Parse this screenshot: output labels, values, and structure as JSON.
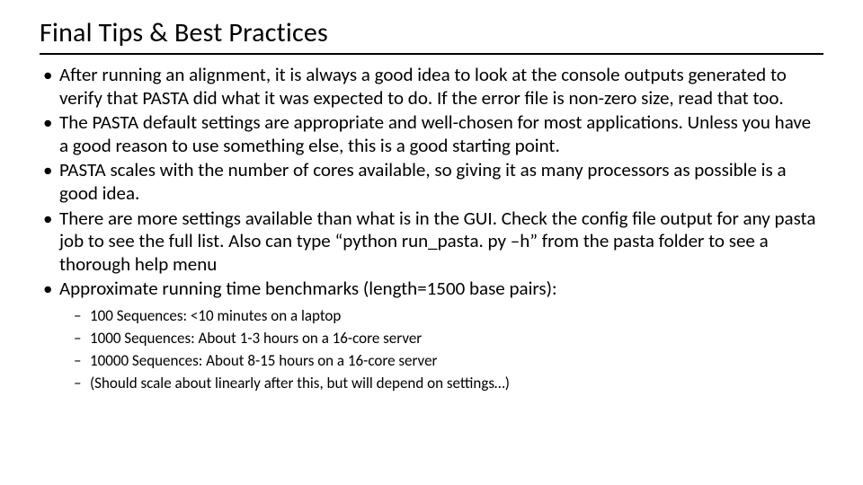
{
  "title": "Final Tips & Best Practices",
  "bullets": [
    "After running an alignment, it is always a good idea to look at the console outputs generated to verify that PASTA did what it was expected to do. If the error file is non-zero size, read that too.",
    "The PASTA default settings are appropriate and well-chosen for most applications. Unless you have a good reason to use something else, this is a good starting point.",
    "PASTA scales with the number of cores available, so giving it as many processors as possible is a good idea.",
    "There are more settings available than what is in the GUI. Check the config file output for any pasta job to see the full list. Also can type “python run_pasta. py –h” from the pasta folder to see a thorough help menu",
    "Approximate running time benchmarks (length=1500 base pairs):"
  ],
  "sub": [
    "100 Sequences: <10 minutes on a laptop",
    "1000 Sequences: About 1-3 hours on a 16-core server",
    "10000 Sequences: About 8-15 hours on a 16-core server",
    "(Should scale about linearly after this, but will depend on settings…)"
  ]
}
